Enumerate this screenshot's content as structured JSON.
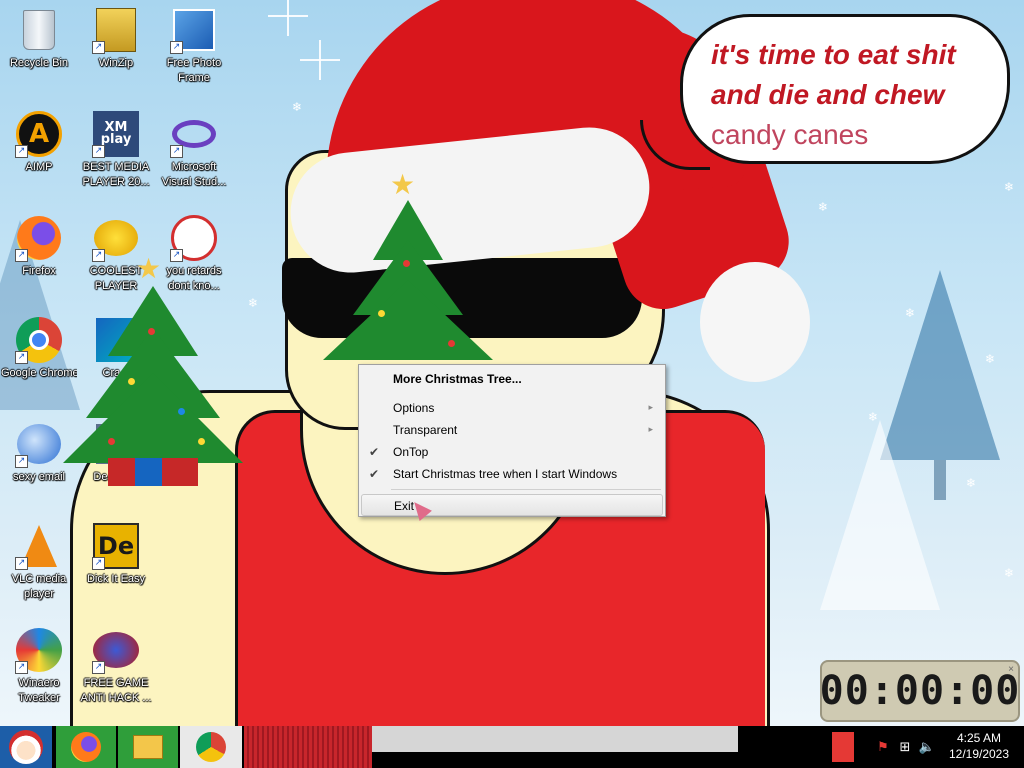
{
  "desktop_icons": [
    {
      "label": "Recycle Bin",
      "icon": "recycle-bin-icon"
    },
    {
      "label": "WinZip",
      "icon": "winzip-icon"
    },
    {
      "label": "Free Photo Frame",
      "icon": "photo-frame-icon"
    },
    {
      "label": "AIMP",
      "icon": "aimp-icon"
    },
    {
      "label": "BEST MEDIA PLAYER 20...",
      "icon": "xmplay-icon",
      "glyph": "XM play"
    },
    {
      "label": "Microsoft Visual Stud...",
      "icon": "visual-studio-icon"
    },
    {
      "label": "Firefox",
      "icon": "firefox-icon"
    },
    {
      "label": "COOLEST PLAYER",
      "icon": "coolest-player-icon"
    },
    {
      "label": "you retards dont kno...",
      "icon": "spider-icon"
    },
    {
      "label": "Google Chrome",
      "icon": "chrome-icon"
    },
    {
      "label": "Cra...",
      "icon": "cra-app-icon"
    },
    {
      "label": "sexy email",
      "icon": "email-icon"
    },
    {
      "label": "De... Spy",
      "icon": "spy-icon"
    },
    {
      "label": "VLC media player",
      "icon": "vlc-icon"
    },
    {
      "label": "Dick It Easy",
      "icon": "de-icon",
      "glyph": "De"
    },
    {
      "label": "Winaero Tweaker",
      "icon": "winaero-icon"
    },
    {
      "label": "FREE GAME ANTI HACK ...",
      "icon": "antihack-icon"
    }
  ],
  "speech_bubble": {
    "line1": "it's time to eat shit",
    "line2": "and die and chew",
    "line3": "candy canes"
  },
  "context_menu": {
    "title": "More Christmas Tree...",
    "items": [
      {
        "label": "Options",
        "submenu": true,
        "checked": false
      },
      {
        "label": "Transparent",
        "submenu": true,
        "checked": false
      },
      {
        "label": "OnTop",
        "submenu": false,
        "checked": true
      },
      {
        "label": "Start Christmas tree when I start Windows",
        "submenu": false,
        "checked": true
      }
    ],
    "exit_label": "Exit",
    "check_glyph": "✔",
    "arrow_glyph": "▸"
  },
  "countdown": {
    "time": "00:00:00",
    "close_glyph": "×"
  },
  "taskbar": {
    "start_icon": "santa-start-icon",
    "apps": [
      "firefox-icon",
      "file-explorer-icon",
      "chrome-icon"
    ],
    "tray_icons": [
      "red-flag-icon",
      "network-icon",
      "volume-icon"
    ],
    "clock_time": "4:25 AM",
    "clock_date": "12/19/2023"
  },
  "colors": {
    "shirt": "#e8262a",
    "skin": "#fcf4c0",
    "hat": "#d9161c",
    "speech_text": "#c01823",
    "menu_bg": "#f2f2f2",
    "taskbar": "#000000"
  }
}
